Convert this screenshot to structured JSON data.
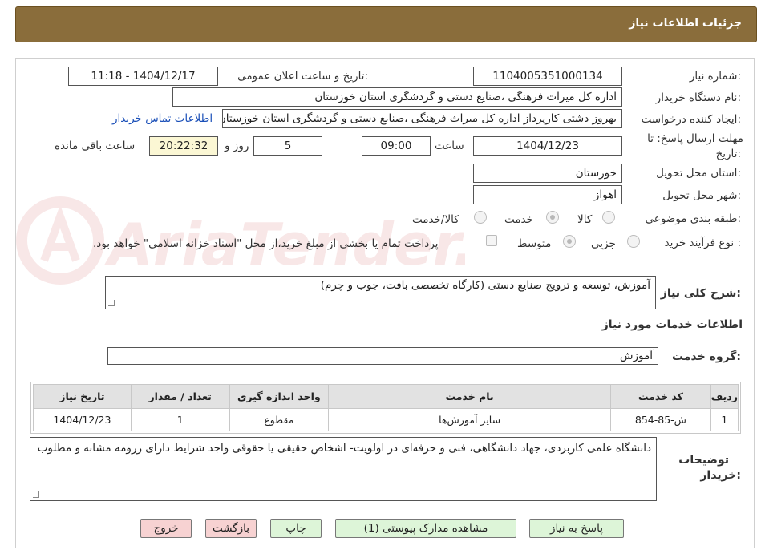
{
  "header": {
    "title": "جزئیات اطلاعات نیاز"
  },
  "watermark": {
    "text": "AriaTender.neT"
  },
  "form": {
    "need_number": {
      "label": "شماره نیاز:",
      "value": "1104005351000134"
    },
    "announce_datetime": {
      "label": "تاریخ و ساعت اعلان عمومی:",
      "value": "1404/12/17 - 11:18"
    },
    "buyer_org": {
      "label": "نام دستگاه خریدار:",
      "value": "اداره کل میراث فرهنگی ،صنایع دستی و گردشگری استان خوزستان"
    },
    "requester": {
      "label": "ایجاد کننده درخواست:",
      "value": "بهروز دشتی کارپرداز اداره کل میراث فرهنگی ،صنایع دستی و گردشگری استان خوزستان"
    },
    "contact_link": "اطلاعات تماس خریدار",
    "deadline": {
      "label_line1": "مهلت ارسال پاسخ: تا",
      "label_line2": "تاریخ:",
      "date": "1404/12/23",
      "time_label": "ساعت",
      "time": "09:00",
      "days": "5",
      "days_label": "روز و",
      "remaining": "20:22:32",
      "remaining_label": "ساعت باقی مانده"
    },
    "province": {
      "label": "استان محل تحویل:",
      "value": "خوزستان"
    },
    "city": {
      "label": "شهر محل تحویل:",
      "value": "اهواز"
    },
    "category": {
      "label": "طبقه بندی موضوعی:",
      "options": [
        "کالا",
        "خدمت",
        "کالا/خدمت"
      ],
      "selected": "خدمت"
    },
    "process": {
      "label": "نوع فرآیند خرید :",
      "options": [
        "جزیی",
        "متوسط"
      ],
      "selected": "متوسط",
      "payment_note": "پرداخت تمام یا بخشی از مبلغ خرید،از محل \"اسناد خزانه اسلامی\" خواهد بود."
    },
    "general_description": {
      "label": "شرح کلی نیاز:",
      "value": "آموزش، توسعه و ترویج صنایع دستی (کارگاه تخصصی بافت، جوب و چرم)"
    },
    "services_title": "اطلاعات خدمات مورد نیاز",
    "service_group": {
      "label": "گروه خدمت:",
      "value": "آموزش"
    }
  },
  "table": {
    "headers": [
      "ردیف",
      "کد خدمت",
      "نام خدمت",
      "واحد اندازه گیری",
      "تعداد / مقدار",
      "تاریخ نیاز"
    ],
    "rows": [
      [
        "1",
        "ش-85-854",
        "سایر آموزش‌ها",
        "مقطوع",
        "1",
        "1404/12/23"
      ]
    ]
  },
  "buyer_notes": {
    "label_line1": "توضیحات",
    "label_line2": "خریدار:",
    "value": "دانشگاه علمی کاربردی، جهاد دانشگاهی، فنی و حرفه‌ای در اولویت- اشخاص حقیقی یا حقوقی واجد شرایط دارای رزومه مشابه و مطلوب"
  },
  "buttons": {
    "reply": "پاسخ به نیاز",
    "attachments": "مشاهده مدارک پیوستی (1)",
    "print": "چاپ",
    "back": "بازگشت",
    "exit": "خروج"
  },
  "colors": {
    "header_bg": "#8a6d3b",
    "remaining_bg": "#fbf7d4",
    "green_btn": "#ddf5d8",
    "pink_btn": "#f7d2d2",
    "link": "#1a4fb8"
  }
}
